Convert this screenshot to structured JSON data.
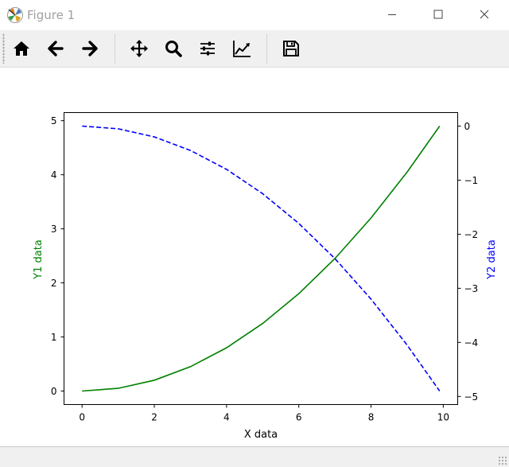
{
  "window": {
    "title": "Figure 1",
    "minimize_glyph": "—",
    "maximize_glyph": "☐",
    "close_glyph": "✕"
  },
  "toolbar": {
    "buttons": [
      {
        "icon": "home-icon",
        "tooltip": "Home"
      },
      {
        "icon": "back-arrow-icon",
        "tooltip": "Back"
      },
      {
        "icon": "forward-arrow-icon",
        "tooltip": "Forward"
      },
      {
        "icon": "pan-icon",
        "tooltip": "Pan"
      },
      {
        "icon": "zoom-icon",
        "tooltip": "Zoom"
      },
      {
        "icon": "subplots-icon",
        "tooltip": "Subplots"
      },
      {
        "icon": "axes-edit-icon",
        "tooltip": "Customize"
      },
      {
        "icon": "save-icon",
        "tooltip": "Save"
      }
    ]
  },
  "chart_data": {
    "type": "line",
    "title": "",
    "xlabel": "X data",
    "ylabel": "Y1 data",
    "y2label": "Y2 data",
    "xlim": [
      -0.5,
      10.4
    ],
    "ylim": [
      -0.25,
      5.15
    ],
    "y2lim": [
      -5.15,
      0.25
    ],
    "xticks": [
      0,
      2,
      4,
      6,
      8,
      10
    ],
    "yticks": [
      0,
      1,
      2,
      3,
      4,
      5
    ],
    "y2ticks": [
      0,
      -1,
      -2,
      -3,
      -4,
      -5
    ],
    "grid": false,
    "series": [
      {
        "axis": "left",
        "color": "#008000",
        "style": "solid",
        "x": [
          0,
          1,
          2,
          3,
          4,
          5,
          6,
          7,
          8,
          9,
          9.9
        ],
        "y": [
          0,
          0.05,
          0.2,
          0.45,
          0.8,
          1.25,
          1.8,
          2.45,
          3.2,
          4.05,
          4.9
        ]
      },
      {
        "axis": "right",
        "color": "#0000ff",
        "style": "dashed",
        "x": [
          0,
          1,
          2,
          3,
          4,
          5,
          6,
          7,
          8,
          9,
          9.9
        ],
        "y": [
          0,
          -0.05,
          -0.2,
          -0.45,
          -0.8,
          -1.25,
          -1.8,
          -2.45,
          -3.2,
          -4.05,
          -4.9
        ]
      }
    ],
    "colors": {
      "y1_label": "#008000",
      "y2_label": "#0000ff",
      "axes": "#000000"
    }
  }
}
